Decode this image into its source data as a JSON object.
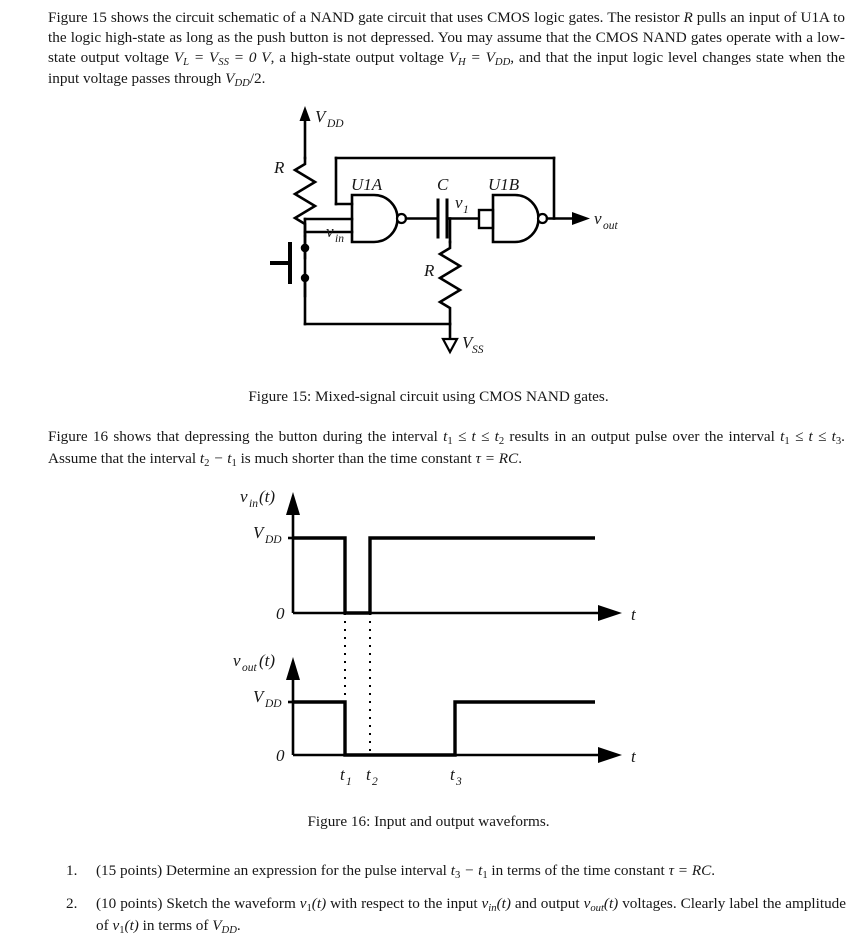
{
  "document": {
    "intro_paragraph": {
      "s1": "Figure 15 shows the circuit schematic of a NAND gate circuit that uses CMOS logic gates. The resistor ",
      "m1": "R",
      "s2": " pulls an input of U1A to the logic high-state as long as the push button is not depressed. You may assume that the CMOS NAND gates operate with a low-state output voltage ",
      "m2": "V",
      "m2sub": "L",
      "m3": " = V",
      "m3sub": "SS",
      "m4": " = 0 V",
      "s3": ", a high-state output voltage ",
      "m5": "V",
      "m5sub": "H",
      "m6": " = V",
      "m6sub": "DD",
      "s4": ", and that the input logic level changes state when the input voltage passes through ",
      "m7": "V",
      "m7sub": "DD",
      "m8": "/2",
      "s5": "."
    },
    "fig16_paragraph": {
      "s1": "Figure 16 shows that depressing the button during the interval ",
      "m1": "t",
      "m1sub": "1",
      "m2": " ≤ t ≤ t",
      "m2sub": "2",
      "s2": " results in an output pulse over the interval ",
      "m3": "t",
      "m3sub": "1",
      "m4": " ≤ t ≤ t",
      "m4sub": "3",
      "s3": ". Assume that the interval ",
      "m5": "t",
      "m5sub": "2",
      "m6": " − t",
      "m6sub": "1",
      "s4": " is much shorter than the time constant ",
      "m7": "τ = RC",
      "s5": "."
    },
    "captions": {
      "figure15": "Figure 15: Mixed-signal circuit using CMOS NAND gates.",
      "figure16": "Figure 16: Input and output waveforms."
    },
    "questions": [
      {
        "number": "1.",
        "s1": "(15 points) Determine an expression for the pulse interval ",
        "m1": "t",
        "m1sub": "3",
        "m2": " − t",
        "m2sub": "1",
        "s2": " in terms of the time constant ",
        "m3": "τ = RC",
        "s3": "."
      },
      {
        "number": "2.",
        "s1": "(10 points) Sketch the waveform ",
        "m1": "v",
        "m1sub": "1",
        "m2": "(t)",
        "s2": " with respect to the input ",
        "m3": "v",
        "m3sub": "in",
        "m4": "(t)",
        "s3": " and output ",
        "m5": "v",
        "m5sub": "out",
        "m6": "(t)",
        "s4": " voltages. Clearly label the amplitude of ",
        "m7": "v",
        "m7sub": "1",
        "m8": "(t)",
        "s5": " in terms of ",
        "m9": "V",
        "m9sub": "DD",
        "s6": "."
      }
    ]
  },
  "circuit": {
    "labels": {
      "vdd": "V",
      "vdd_sub": "DD",
      "vss": "V",
      "vss_sub": "SS",
      "r_pullup": "R",
      "r_pulldown": "R",
      "cap": "C",
      "gate_a": "U1A",
      "gate_b": "U1B",
      "vin": "v",
      "vin_sub": "in",
      "v1": "v",
      "v1_sub": "1",
      "vout": "v",
      "vout_sub": "out"
    },
    "stroke_color": "#000000"
  },
  "chart_data": [
    {
      "type": "line",
      "title": "Input waveform",
      "ylabel": "v_in(t)",
      "xlabel": "t",
      "y_ticks": [
        "V_DD",
        "0"
      ],
      "y_tick_labels": {
        "high": "V",
        "high_sub": "DD",
        "zero": "0"
      },
      "x_tick_labels": [],
      "ylim": [
        0,
        1
      ],
      "grid": false,
      "legend": null,
      "x": [
        0,
        345,
        345,
        370,
        370,
        595
      ],
      "values": [
        1,
        1,
        0,
        0,
        1,
        1
      ],
      "description": "v_in is at V_DD, drops to 0 at t1, returns to V_DD at t2 and stays high."
    },
    {
      "type": "line",
      "title": "Output waveform",
      "ylabel": "v_out(t)",
      "xlabel": "t",
      "y_ticks": [
        "V_DD",
        "0"
      ],
      "y_tick_labels": {
        "high": "V",
        "high_sub": "DD",
        "zero": "0"
      },
      "x_tick_labels": [
        {
          "label": "t",
          "sub": "1"
        },
        {
          "label": "t",
          "sub": "2"
        },
        {
          "label": "t",
          "sub": "3"
        }
      ],
      "ylim": [
        0,
        1
      ],
      "grid": false,
      "legend": null,
      "x": [
        0,
        345,
        345,
        455,
        455,
        595
      ],
      "values": [
        1,
        1,
        0,
        0,
        1,
        1
      ],
      "description": "v_out is at V_DD, drops to 0 at t1, returns to V_DD at t3 and stays high."
    }
  ]
}
